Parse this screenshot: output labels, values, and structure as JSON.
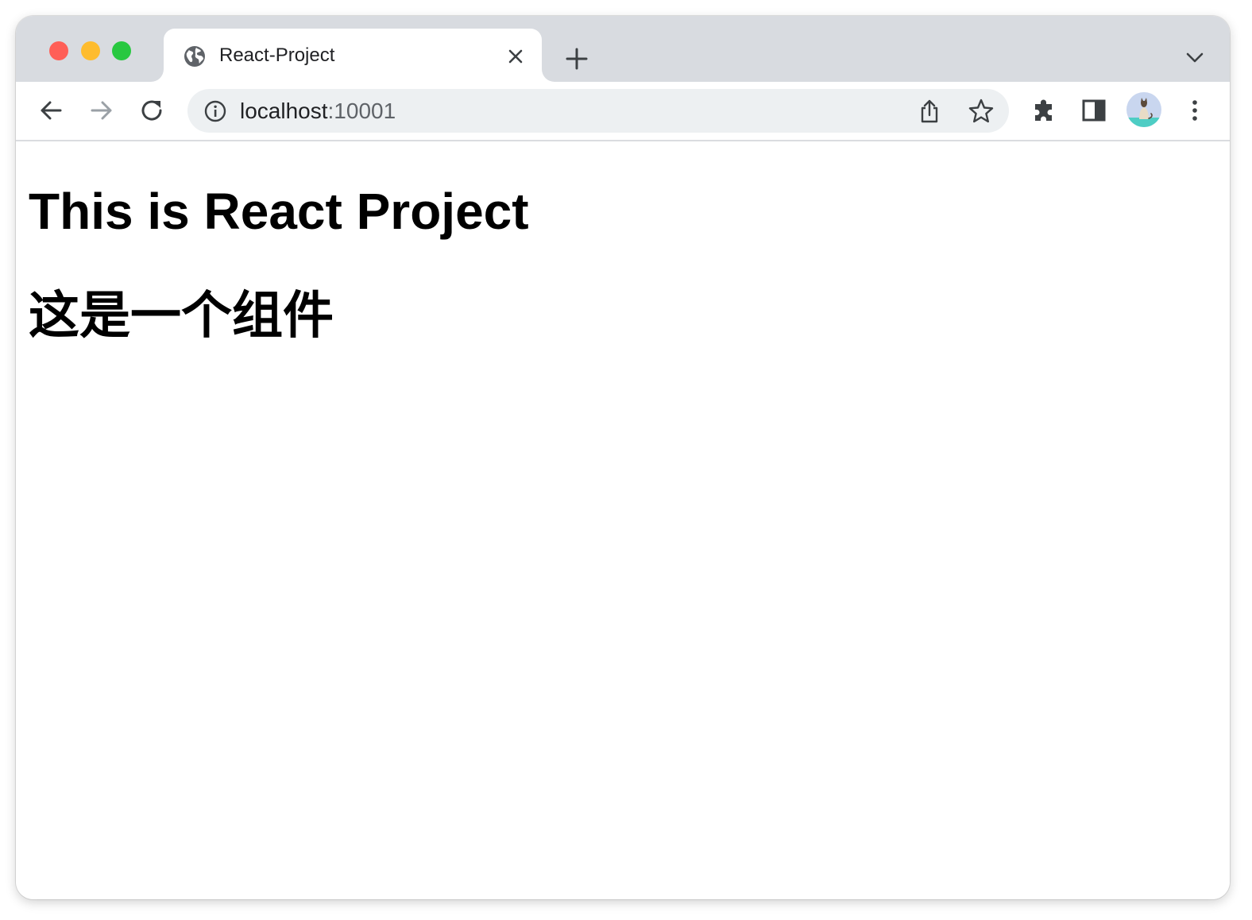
{
  "window": {
    "colors": {
      "close": "#ff5f57",
      "minimize": "#febc2e",
      "zoom": "#28c840",
      "chrome": "#d8dbe0",
      "omnibox": "#edf0f2"
    },
    "controls": {
      "close_icon": "traffic-light-close",
      "minimize_icon": "traffic-light-minimize",
      "zoom_icon": "traffic-light-zoom"
    }
  },
  "tabs": [
    {
      "title": "React-Project",
      "favicon": "globe-icon",
      "active": true
    }
  ],
  "toolbar": {
    "back_icon": "arrow-left-icon",
    "forward_icon": "arrow-right-icon",
    "reload_icon": "reload-icon",
    "address": {
      "host": "localhost",
      "port": ":10001",
      "site_info_icon": "info-icon"
    },
    "share_icon": "share-icon",
    "bookmark_icon": "star-icon",
    "extensions_icon": "puzzle-icon",
    "side_panel_icon": "side-panel-icon",
    "profile_icon": "avatar",
    "menu_icon": "kebab-menu-icon"
  },
  "page": {
    "heading_en": "This is React Project",
    "heading_zh": "这是一个组件"
  }
}
